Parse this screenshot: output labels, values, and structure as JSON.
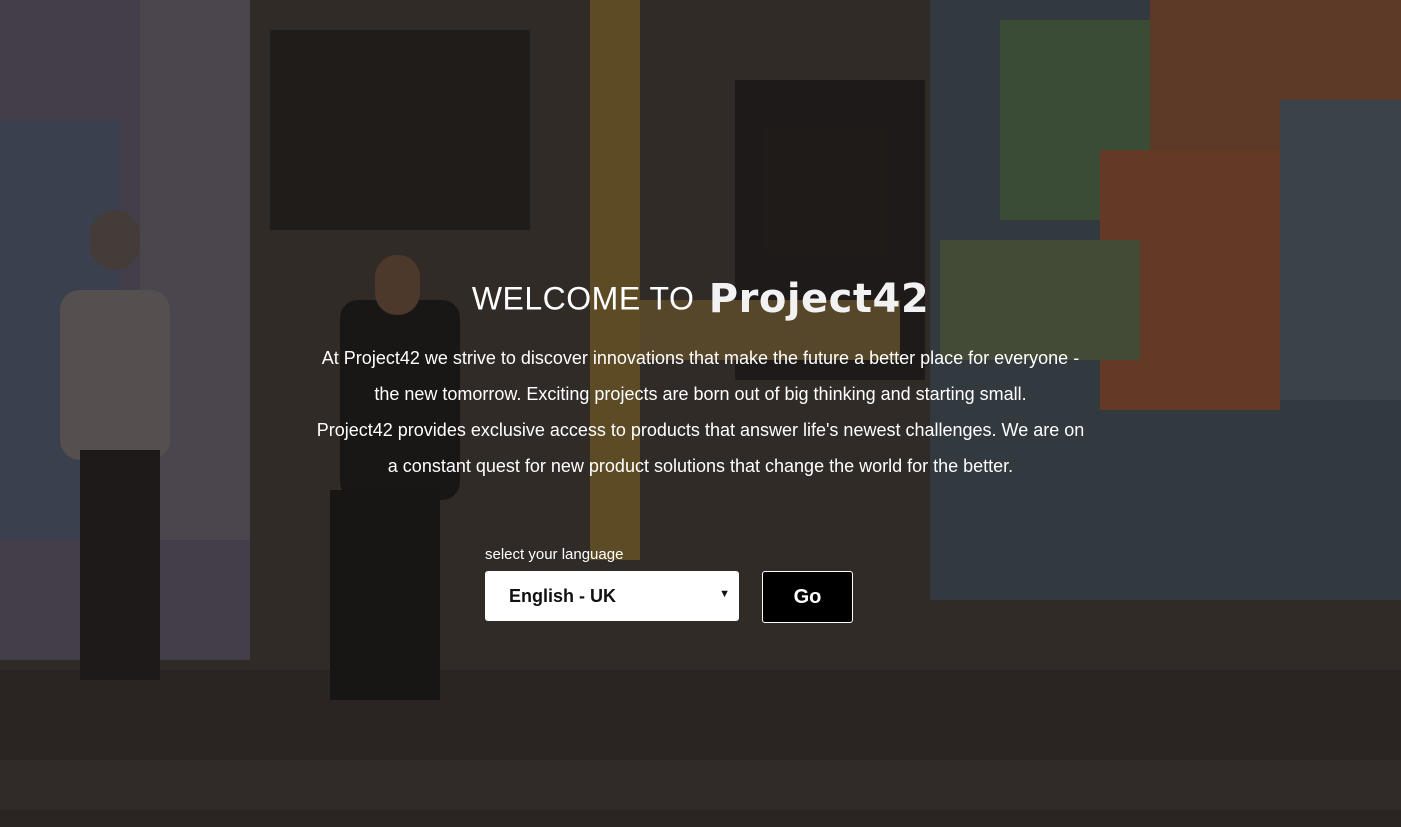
{
  "header": {
    "welcome_prefix": "WELCOME TO",
    "brand_name": "Project42"
  },
  "intro": {
    "lines": [
      "At Project42 we strive to discover innovations that make the future a better place for everyone -",
      "the new tomorrow. Exciting projects are born out of big thinking and starting small.",
      "Project42 provides exclusive access to products that answer life's newest challenges. We are on",
      "a constant quest for new product solutions that change the world for the better."
    ]
  },
  "language": {
    "label": "select your language",
    "selected": "English - UK",
    "caret_icon": "chevron-down-icon"
  },
  "actions": {
    "go_label": "Go"
  },
  "colors": {
    "text": "#ffffff",
    "button_bg": "#000000",
    "select_bg": "#ffffff"
  }
}
